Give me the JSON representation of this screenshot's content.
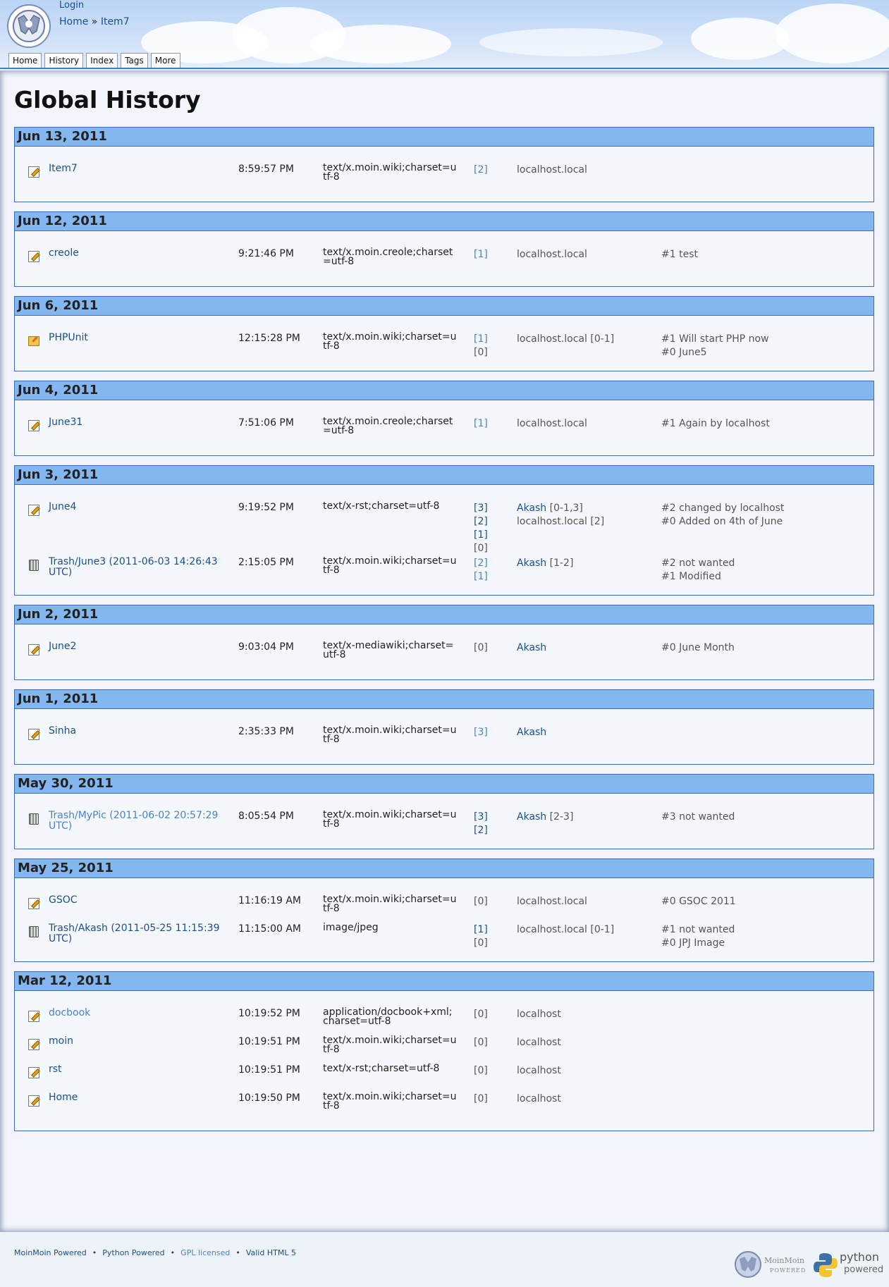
{
  "header": {
    "login": "Login",
    "breadcrumb": {
      "home": "Home",
      "separator": "»",
      "current": "Item7"
    },
    "tabs": [
      "Home",
      "History",
      "Index",
      "Tags",
      "More"
    ]
  },
  "page_title": "Global History",
  "days": [
    {
      "date": "Jun 13, 2011",
      "entries": [
        {
          "icon": "edit",
          "name": "Item7",
          "visited": false,
          "time": "8:59:57 PM",
          "ctype": "text/x.moin.wiki;charset=utf-8",
          "revs": [
            {
              "t": "[2]",
              "k": "rl"
            }
          ],
          "authors": [
            {
              "t": "localhost.local",
              "link": false
            }
          ],
          "comments": []
        }
      ]
    },
    {
      "date": "Jun 12, 2011",
      "entries": [
        {
          "icon": "edit",
          "name": "creole",
          "visited": false,
          "time": "9:21:46 PM",
          "ctype": "text/x.moin.creole;charset=utf-8",
          "revs": [
            {
              "t": "[1]",
              "k": "rl"
            }
          ],
          "authors": [
            {
              "t": "localhost.local",
              "link": false
            }
          ],
          "comments": [
            "#1 test"
          ]
        }
      ]
    },
    {
      "date": "Jun 6, 2011",
      "entries": [
        {
          "icon": "folder",
          "name": "PHPUnit",
          "visited": false,
          "time": "12:15:28 PM",
          "ctype": "text/x.moin.wiki;charset=utf-8",
          "revs": [
            {
              "t": "[1]",
              "k": "rl"
            },
            {
              "t": "[0]",
              "k": "rn"
            }
          ],
          "authors": [
            {
              "t": "localhost.local [0-1]",
              "link": false
            }
          ],
          "comments": [
            "#1 Will start PHP now",
            "#0 June5"
          ]
        }
      ]
    },
    {
      "date": "Jun 4, 2011",
      "entries": [
        {
          "icon": "edit",
          "name": "June31",
          "visited": false,
          "time": "7:51:06 PM",
          "ctype": "text/x.moin.creole;charset=utf-8",
          "revs": [
            {
              "t": "[1]",
              "k": "rl"
            }
          ],
          "authors": [
            {
              "t": "localhost.local",
              "link": false
            }
          ],
          "comments": [
            "#1 Again by localhost"
          ]
        }
      ]
    },
    {
      "date": "Jun 3, 2011",
      "entries": [
        {
          "icon": "edit",
          "name": "June4",
          "visited": false,
          "time": "9:19:52 PM",
          "ctype": "text/x-rst;charset=utf-8",
          "revs": [
            {
              "t": "[3]",
              "k": "rv"
            },
            {
              "t": "[2]",
              "k": "rv"
            },
            {
              "t": "[1]",
              "k": "rv"
            },
            {
              "t": "[0]",
              "k": "rn"
            }
          ],
          "authors": [
            {
              "t": "Akash",
              "link": true,
              "extra": " [0-1,3]"
            },
            {
              "t": "localhost.local [2]",
              "link": false
            }
          ],
          "comments": [
            "#2 changed by localhost",
            "#0 Added on 4th of June"
          ]
        },
        {
          "icon": "trash",
          "name": "Trash/June3 (2011-06-03 14:26:43 UTC)",
          "visited": false,
          "time": "2:15:05 PM",
          "ctype": "text/x.moin.wiki;charset=utf-8",
          "revs": [
            {
              "t": "[2]",
              "k": "rl"
            },
            {
              "t": "[1]",
              "k": "rl"
            }
          ],
          "authors": [
            {
              "t": "Akash",
              "link": true,
              "extra": " [1-2]"
            }
          ],
          "comments": [
            "#2 not wanted",
            "#1 Modified"
          ]
        }
      ]
    },
    {
      "date": "Jun 2, 2011",
      "entries": [
        {
          "icon": "edit",
          "name": "June2",
          "visited": false,
          "time": "9:03:04 PM",
          "ctype": "text/x-mediawiki;charset=utf-8",
          "revs": [
            {
              "t": "[0]",
              "k": "rn"
            }
          ],
          "authors": [
            {
              "t": "Akash",
              "link": true,
              "extra": ""
            }
          ],
          "comments": [
            "#0 June Month"
          ]
        }
      ]
    },
    {
      "date": "Jun 1, 2011",
      "entries": [
        {
          "icon": "edit",
          "name": "Sinha",
          "visited": false,
          "time": "2:35:33 PM",
          "ctype": "text/x.moin.wiki;charset=utf-8",
          "revs": [
            {
              "t": "[3]",
              "k": "rl"
            }
          ],
          "authors": [
            {
              "t": "Akash",
              "link": true,
              "extra": ""
            }
          ],
          "comments": []
        }
      ]
    },
    {
      "date": "May 30, 2011",
      "entries": [
        {
          "icon": "trash",
          "name": "Trash/MyPic (2011-06-02 20:57:29 UTC)",
          "visited": true,
          "time": "8:05:54 PM",
          "ctype": "text/x.moin.wiki;charset=utf-8",
          "revs": [
            {
              "t": "[3]",
              "k": "rv"
            },
            {
              "t": "[2]",
              "k": "rv"
            }
          ],
          "authors": [
            {
              "t": "Akash",
              "link": true,
              "extra": " [2-3]"
            }
          ],
          "comments": [
            "#3 not wanted"
          ]
        }
      ]
    },
    {
      "date": "May 25, 2011",
      "entries": [
        {
          "icon": "edit",
          "name": "GSOC",
          "visited": false,
          "time": "11:16:19 AM",
          "ctype": "text/x.moin.wiki;charset=utf-8",
          "revs": [
            {
              "t": "[0]",
              "k": "rn"
            }
          ],
          "authors": [
            {
              "t": "localhost.local",
              "link": false
            }
          ],
          "comments": [
            "#0 GSOC 2011"
          ]
        },
        {
          "icon": "trash",
          "name": "Trash/Akash (2011-05-25 11:15:39 UTC)",
          "visited": false,
          "time": "11:15:00 AM",
          "ctype": "image/jpeg",
          "revs": [
            {
              "t": "[1]",
              "k": "rv"
            },
            {
              "t": "[0]",
              "k": "rn"
            }
          ],
          "authors": [
            {
              "t": "localhost.local [0-1]",
              "link": false
            }
          ],
          "comments": [
            "#1 not wanted",
            "#0 JPJ Image"
          ]
        }
      ]
    },
    {
      "date": "Mar 12, 2011",
      "entries": [
        {
          "icon": "edit",
          "name": "docbook",
          "visited": true,
          "time": "10:19:52 PM",
          "ctype": "application/docbook+xml;charset=utf-8",
          "revs": [
            {
              "t": "[0]",
              "k": "rn"
            }
          ],
          "authors": [
            {
              "t": "localhost",
              "link": false
            }
          ],
          "comments": []
        },
        {
          "icon": "edit",
          "name": "moin",
          "visited": false,
          "time": "10:19:51 PM",
          "ctype": "text/x.moin.wiki;charset=utf-8",
          "revs": [
            {
              "t": "[0]",
              "k": "rn"
            }
          ],
          "authors": [
            {
              "t": "localhost",
              "link": false
            }
          ],
          "comments": []
        },
        {
          "icon": "edit",
          "name": "rst",
          "visited": false,
          "time": "10:19:51 PM",
          "ctype": "text/x-rst;charset=utf-8",
          "revs": [
            {
              "t": "[0]",
              "k": "rn"
            }
          ],
          "authors": [
            {
              "t": "localhost",
              "link": false
            }
          ],
          "comments": []
        },
        {
          "icon": "edit",
          "name": "Home",
          "visited": false,
          "time": "10:19:50 PM",
          "ctype": "text/x.moin.wiki;charset=utf-8",
          "revs": [
            {
              "t": "[0]",
              "k": "rn"
            }
          ],
          "authors": [
            {
              "t": "localhost",
              "link": false
            }
          ],
          "comments": []
        }
      ]
    }
  ],
  "footer": {
    "links": [
      "MoinMoin Powered",
      "Python Powered",
      "GPL licensed",
      "Valid HTML 5"
    ],
    "separator": "•",
    "moin_badge": {
      "name": "MoinMoin",
      "sub": "POWERED"
    },
    "python_badge": {
      "name": "python",
      "sub": "powered"
    }
  }
}
